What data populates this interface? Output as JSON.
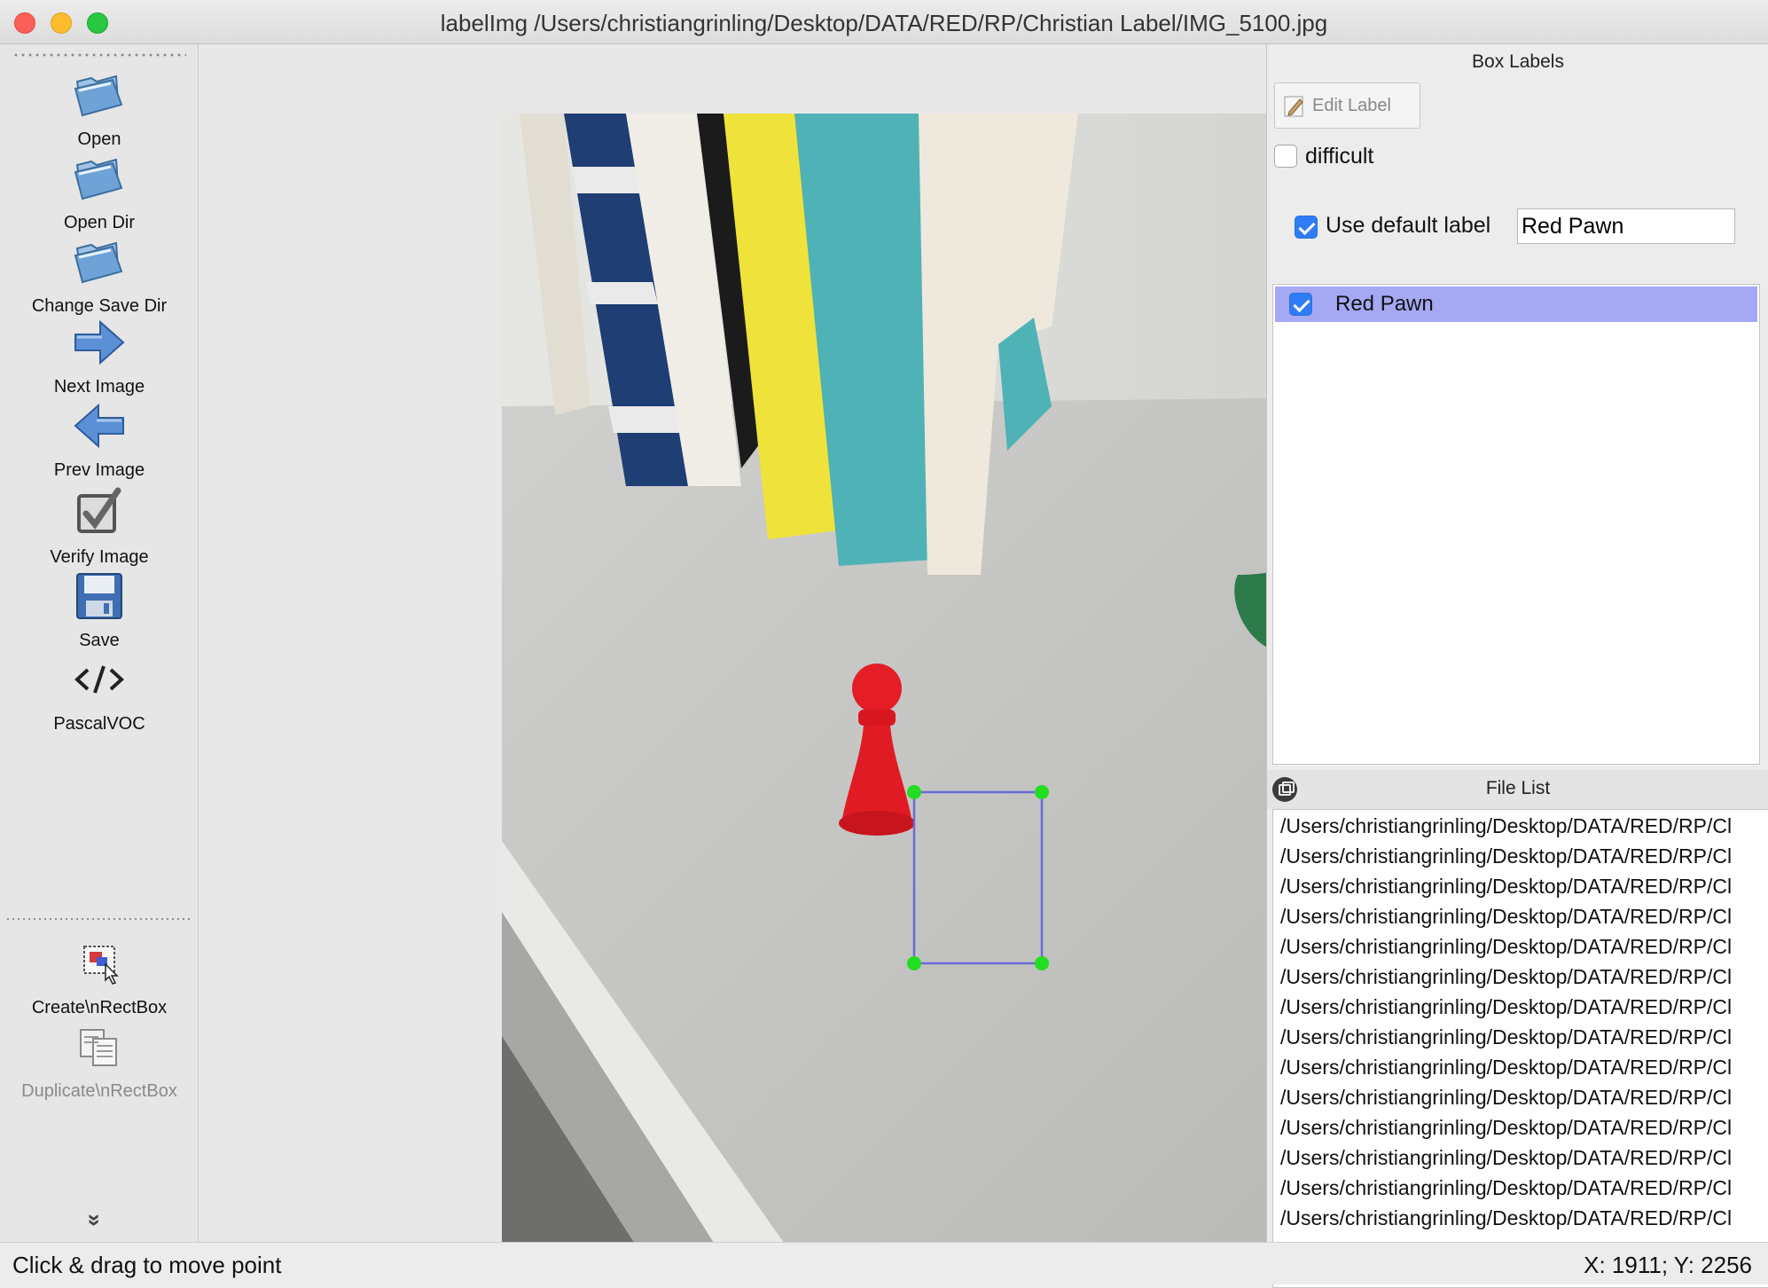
{
  "window": {
    "title": "labelImg /Users/christiangrinling/Desktop/DATA/RED/RP/Christian Label/IMG_5100.jpg"
  },
  "toolbar": {
    "items": [
      {
        "label": "Open",
        "icon": "folder-open-icon",
        "enabled": true
      },
      {
        "label": "Open Dir",
        "icon": "folder-open-icon",
        "enabled": true
      },
      {
        "label": "Change Save Dir",
        "icon": "folder-open-icon",
        "enabled": true
      },
      {
        "label": "Next Image",
        "icon": "arrow-right-icon",
        "enabled": true
      },
      {
        "label": "Prev Image",
        "icon": "arrow-left-icon",
        "enabled": true
      },
      {
        "label": "Verify Image",
        "icon": "verify-check-icon",
        "enabled": true
      },
      {
        "label": "Save",
        "icon": "floppy-disk-icon",
        "enabled": true
      },
      {
        "label": "PascalVOC",
        "icon": "code-tag-icon",
        "enabled": true
      },
      {
        "label": "Create\\nRectBox",
        "icon": "create-rect-icon",
        "enabled": true
      },
      {
        "label": "Duplicate\\nRectBox",
        "icon": "duplicate-rect-icon",
        "enabled": false
      }
    ],
    "more_glyph": "»"
  },
  "canvas": {
    "annotation_label": "Red Pawn",
    "box_color": "#6a6ad8",
    "handle_color": "#22dd22"
  },
  "box_labels": {
    "title": "Box Labels",
    "edit_label": "Edit Label",
    "difficult_label": "difficult",
    "difficult_checked": false,
    "use_default_label": "Use default label",
    "use_default_checked": true,
    "default_label_value": "Red Pawn",
    "labels": [
      {
        "name": "Red Pawn",
        "checked": true
      }
    ]
  },
  "file_list": {
    "title": "File List",
    "files": [
      "/Users/christiangrinling/Desktop/DATA/RED/RP/Cl",
      "/Users/christiangrinling/Desktop/DATA/RED/RP/Cl",
      "/Users/christiangrinling/Desktop/DATA/RED/RP/Cl",
      "/Users/christiangrinling/Desktop/DATA/RED/RP/Cl",
      "/Users/christiangrinling/Desktop/DATA/RED/RP/Cl",
      "/Users/christiangrinling/Desktop/DATA/RED/RP/Cl",
      "/Users/christiangrinling/Desktop/DATA/RED/RP/Cl",
      "/Users/christiangrinling/Desktop/DATA/RED/RP/Cl",
      "/Users/christiangrinling/Desktop/DATA/RED/RP/Cl",
      "/Users/christiangrinling/Desktop/DATA/RED/RP/Cl",
      "/Users/christiangrinling/Desktop/DATA/RED/RP/Cl",
      "/Users/christiangrinling/Desktop/DATA/RED/RP/Cl",
      "/Users/christiangrinling/Desktop/DATA/RED/RP/Cl",
      "/Users/christiangrinling/Desktop/DATA/RED/RP/Cl"
    ]
  },
  "status": {
    "message": "Click & drag to move point",
    "coordinates": "X: 1911; Y: 2256"
  },
  "colors": {
    "accent": "#2f7cf6",
    "selection": "#a5a8f3"
  }
}
